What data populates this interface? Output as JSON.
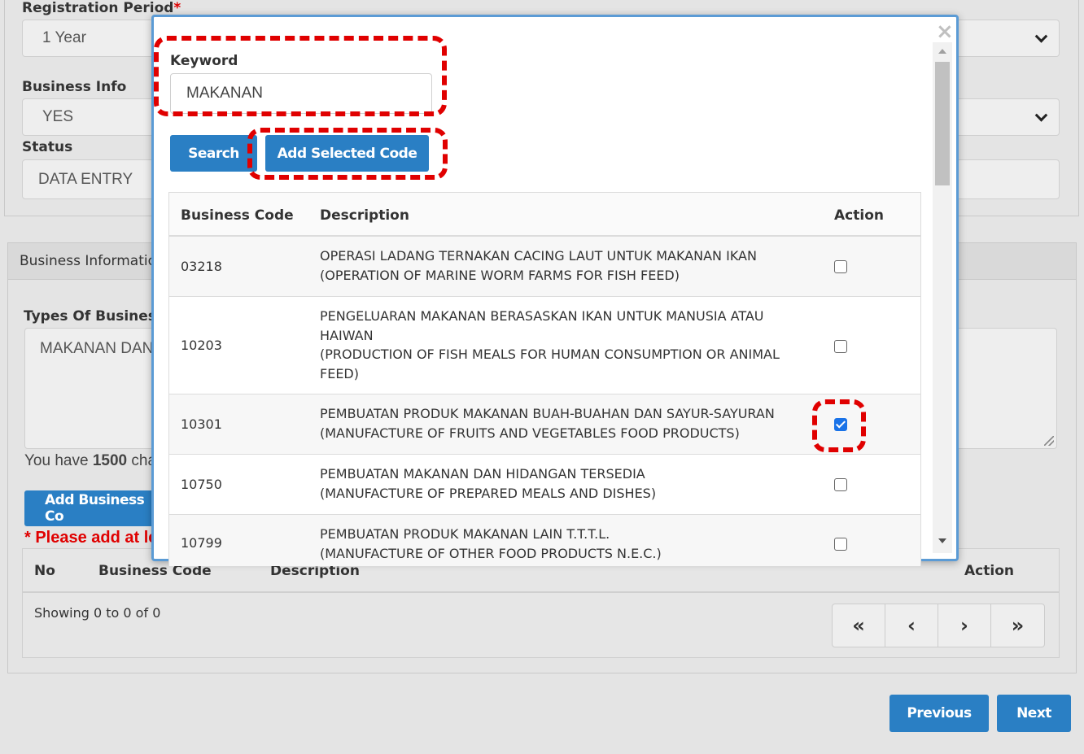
{
  "background": {
    "registration_period": {
      "label": "Registration Period",
      "required_mark": "*",
      "value": "1 Year"
    },
    "business_info": {
      "label": "Business Info",
      "value": "YES"
    },
    "status": {
      "label": "Status",
      "value": "DATA ENTRY"
    },
    "business_information_panel": {
      "title": "Business Informatio",
      "types_label": "Types Of Business",
      "types_value": "MAKANAN DAN",
      "char_note_prefix": "You have ",
      "char_count": "1500",
      "char_note_suffix": " cha",
      "add_business_code_button": "Add Business Co",
      "warning": "* Please add at le",
      "table_headers": {
        "no": "No",
        "business_code": "Business Code",
        "description": "Description",
        "action": "Action"
      },
      "showing_text": "Showing 0 to 0 of 0",
      "pager": {
        "first": "«",
        "prev": "‹",
        "next": "›",
        "last": "»"
      }
    },
    "previous_button": "Previous",
    "next_button": "Next"
  },
  "modal": {
    "close": "×",
    "keyword_label": "Keyword",
    "keyword_value": "MAKANAN",
    "search_button": "Search",
    "add_selected_button": "Add Selected Code",
    "table_headers": {
      "business_code": "Business Code",
      "description": "Description",
      "action": "Action"
    },
    "rows": [
      {
        "code": "03218",
        "desc": [
          "OPERASI LADANG TERNAKAN CACING LAUT UNTUK MAKANAN IKAN",
          "(OPERATION OF MARINE WORM FARMS FOR FISH FEED)"
        ],
        "checked": false
      },
      {
        "code": "10203",
        "desc": [
          "PENGELUARAN MAKANAN BERASASKAN IKAN UNTUK MANUSIA ATAU",
          "HAIWAN",
          "(PRODUCTION OF FISH MEALS FOR HUMAN CONSUMPTION OR ANIMAL",
          "FEED)"
        ],
        "checked": false
      },
      {
        "code": "10301",
        "desc": [
          "PEMBUATAN PRODUK MAKANAN BUAH-BUAHAN DAN SAYUR-SAYURAN",
          "(MANUFACTURE OF FRUITS AND VEGETABLES FOOD PRODUCTS)"
        ],
        "checked": true
      },
      {
        "code": "10750",
        "desc": [
          "PEMBUATAN MAKANAN DAN HIDANGAN TERSEDIA",
          "(MANUFACTURE OF PREPARED MEALS AND DISHES)"
        ],
        "checked": false
      },
      {
        "code": "10799",
        "desc": [
          "PEMBUATAN PRODUK MAKANAN LAIN T.T.T.L.",
          "(MANUFACTURE OF OTHER FOOD PRODUCTS N.E.C.)"
        ],
        "checked": false
      }
    ]
  },
  "colors": {
    "primary": "#2a7fc4",
    "highlight": "#e00000",
    "checkbox_checked": "#1a73e8"
  }
}
